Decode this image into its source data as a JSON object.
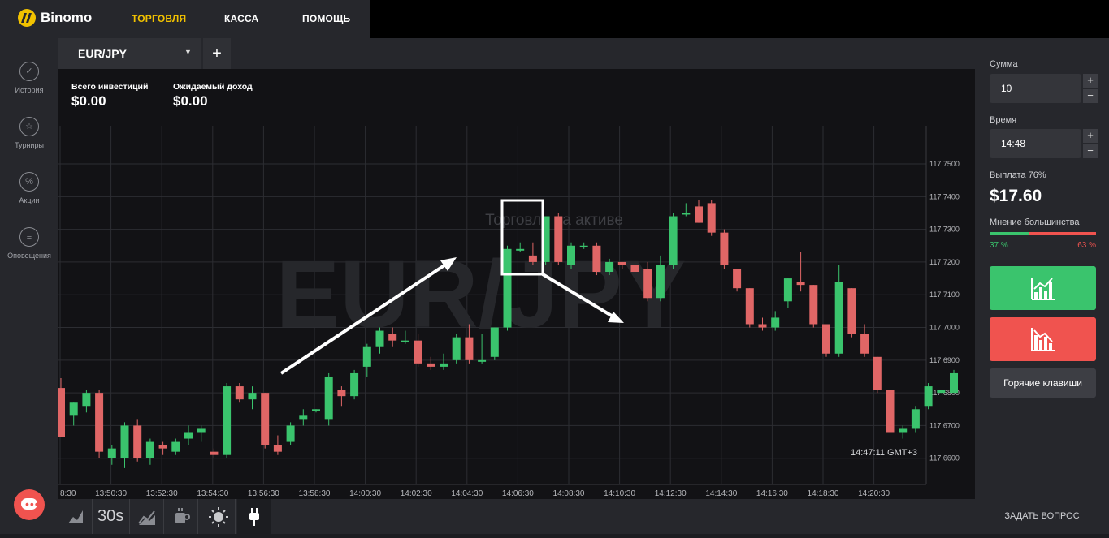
{
  "brand": {
    "name": "Binomo"
  },
  "nav": {
    "items": [
      "ТОРГОВЛЯ",
      "КАССА",
      "ПОМОЩЬ"
    ],
    "active_color": "#f2c200"
  },
  "sidebar": {
    "items": [
      {
        "label": "История",
        "icon": "check-circle-icon"
      },
      {
        "label": "Турниры",
        "icon": "trophy-icon"
      },
      {
        "label": "Акции",
        "icon": "percent-icon"
      },
      {
        "label": "Оповещения",
        "icon": "notifications-icon"
      }
    ]
  },
  "tab": {
    "asset": "EUR/JPY",
    "add": "+"
  },
  "stats": {
    "invest_label": "Всего инвестиций",
    "invest_value": "$0.00",
    "income_label": "Ожидаемый доход",
    "income_value": "$0.00"
  },
  "chart": {
    "watermark": "EUR/JPY",
    "overlay_text": "Торговля на активе",
    "clock": "14:47:11 GMT+3",
    "y_ticks": [
      "117.7500",
      "117.7400",
      "117.7300",
      "117.7200",
      "117.7100",
      "117.7000",
      "117.6900",
      "117.6800",
      "117.6700",
      "117.6600"
    ],
    "x_ticks": [
      "8:30",
      "13:50:30",
      "13:52:30",
      "13:54:30",
      "13:56:30",
      "13:58:30",
      "14:00:30",
      "14:02:30",
      "14:04:30",
      "14:06:30",
      "14:08:30",
      "14:10:30",
      "14:12:30",
      "14:14:30",
      "14:16:30",
      "14:18:30",
      "14:20:30"
    ],
    "colors": {
      "up": "#3ac46d",
      "down": "#e06666"
    }
  },
  "chart_data": {
    "type": "candlestick",
    "title": "EUR/JPY",
    "ylim": [
      117.665,
      117.751
    ],
    "candles": [
      [
        117.6815,
        117.6665,
        117.6845,
        117.6665
      ],
      [
        117.673,
        117.677,
        117.67,
        117.677
      ],
      [
        117.676,
        117.68,
        117.674,
        117.681
      ],
      [
        117.68,
        117.662,
        117.66,
        117.681
      ],
      [
        117.66,
        117.663,
        117.658,
        117.664
      ],
      [
        117.66,
        117.67,
        117.657,
        117.671
      ],
      [
        117.67,
        117.66,
        117.659,
        117.672
      ],
      [
        117.66,
        117.665,
        117.658,
        117.666
      ],
      [
        117.664,
        117.663,
        117.661,
        117.665
      ],
      [
        117.662,
        117.665,
        117.661,
        117.666
      ],
      [
        117.666,
        117.668,
        117.664,
        117.67
      ],
      [
        117.668,
        117.669,
        117.665,
        117.67
      ],
      [
        117.662,
        117.661,
        117.66,
        117.663
      ],
      [
        117.661,
        117.682,
        117.66,
        117.683
      ],
      [
        117.682,
        117.678,
        117.677,
        117.683
      ],
      [
        117.678,
        117.68,
        117.675,
        117.682
      ],
      [
        117.68,
        117.664,
        117.663,
        117.68
      ],
      [
        117.664,
        117.662,
        117.661,
        117.667
      ],
      [
        117.665,
        117.67,
        117.664,
        117.671
      ],
      [
        117.672,
        117.673,
        117.67,
        117.675
      ],
      [
        117.675,
        117.675,
        117.674,
        117.675
      ],
      [
        117.672,
        117.685,
        117.67,
        117.686
      ],
      [
        117.681,
        117.679,
        117.676,
        117.682
      ],
      [
        117.679,
        117.686,
        117.678,
        117.687
      ],
      [
        117.688,
        117.694,
        117.685,
        117.695
      ],
      [
        117.694,
        117.699,
        117.692,
        117.7
      ],
      [
        117.698,
        117.696,
        117.694,
        117.7
      ],
      [
        117.696,
        117.696,
        117.695,
        117.699
      ],
      [
        117.696,
        117.689,
        117.688,
        117.698
      ],
      [
        117.689,
        117.688,
        117.687,
        117.691
      ],
      [
        117.688,
        117.689,
        117.687,
        117.692
      ],
      [
        117.69,
        117.697,
        117.689,
        117.698
      ],
      [
        117.697,
        117.69,
        117.689,
        117.701
      ],
      [
        117.69,
        117.69,
        117.689,
        117.698
      ],
      [
        117.691,
        117.7,
        117.69,
        117.7
      ],
      [
        117.7,
        117.724,
        117.699,
        117.725
      ],
      [
        117.724,
        117.724,
        117.723,
        117.726
      ],
      [
        117.722,
        117.72,
        117.719,
        117.726
      ],
      [
        117.72,
        117.734,
        117.719,
        117.734
      ],
      [
        117.734,
        117.72,
        117.719,
        117.735
      ],
      [
        117.719,
        117.725,
        117.718,
        117.726
      ],
      [
        117.725,
        117.725,
        117.724,
        117.726
      ],
      [
        117.725,
        117.717,
        117.716,
        117.726
      ],
      [
        117.717,
        117.72,
        117.716,
        117.721
      ],
      [
        117.72,
        117.719,
        117.718,
        117.72
      ],
      [
        117.719,
        117.717,
        117.716,
        117.719
      ],
      [
        117.718,
        117.709,
        117.708,
        117.72
      ],
      [
        117.709,
        117.719,
        117.708,
        117.722
      ],
      [
        117.719,
        117.734,
        117.718,
        117.735
      ],
      [
        117.735,
        117.735,
        117.734,
        117.738
      ],
      [
        117.737,
        117.732,
        117.732,
        117.739
      ],
      [
        117.738,
        117.729,
        117.728,
        117.739
      ],
      [
        117.729,
        117.719,
        117.718,
        117.73
      ],
      [
        117.718,
        117.712,
        117.711,
        117.718
      ],
      [
        117.712,
        117.701,
        117.7,
        117.712
      ],
      [
        117.701,
        117.7,
        117.699,
        117.703
      ],
      [
        117.7,
        117.703,
        117.699,
        117.705
      ],
      [
        117.708,
        117.715,
        117.706,
        117.715
      ],
      [
        117.714,
        117.713,
        117.711,
        117.723
      ],
      [
        117.713,
        117.701,
        117.7,
        117.713
      ],
      [
        117.701,
        117.692,
        117.691,
        117.701
      ],
      [
        117.692,
        117.714,
        117.691,
        117.719
      ],
      [
        117.712,
        117.698,
        117.697,
        117.712
      ],
      [
        117.698,
        117.692,
        117.691,
        117.701
      ],
      [
        117.691,
        117.681,
        117.68,
        117.691
      ],
      [
        117.681,
        117.668,
        117.666,
        117.681
      ],
      [
        117.668,
        117.669,
        117.666,
        117.67
      ],
      [
        117.669,
        117.675,
        117.668,
        117.676
      ],
      [
        117.676,
        117.682,
        117.675,
        117.683
      ],
      [
        117.68,
        117.681,
        117.68,
        117.681
      ],
      [
        117.68,
        117.686,
        117.68,
        117.687
      ]
    ]
  },
  "toolbar": {
    "timeframe": "30s",
    "icons": [
      "area-chart-icon",
      "timeframe-icon",
      "indicators-icon",
      "coffee-icon",
      "brightness-icon",
      "plug-icon"
    ]
  },
  "panel": {
    "sum_label": "Сумма",
    "sum_value": "10",
    "time_label": "Время",
    "time_value": "14:48",
    "payout_label": "Выплата 76%",
    "payout_value": "$17.60",
    "opinion_label": "Мнение большинства",
    "opinion_up": "37 %",
    "opinion_down": "63 %",
    "opinion_up_fraction": 0.37,
    "hotkeys": "Горячие клавиши",
    "ask": "ЗАДАТЬ ВОПРОС"
  }
}
